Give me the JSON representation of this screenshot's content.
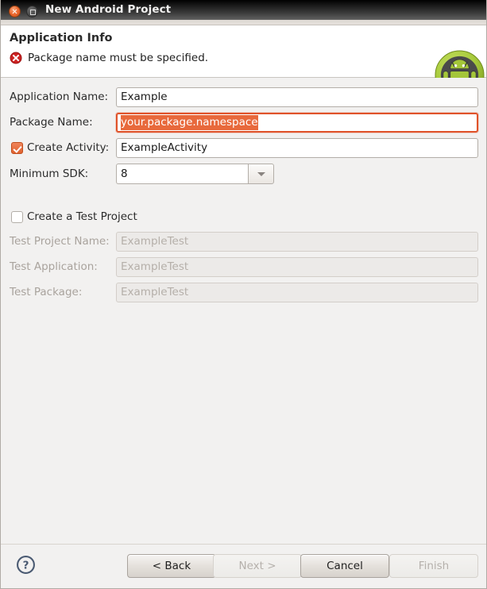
{
  "window": {
    "title": "New Android Project",
    "close_icon": "close-icon",
    "maximize_icon": "maximize-icon"
  },
  "header": {
    "title": "Application Info",
    "error_icon": "error-icon",
    "error_message": "Package name must be specified.",
    "logo_icon": "android-robot-icon"
  },
  "form": {
    "application_name": {
      "label": "Application Name:",
      "value": "Example"
    },
    "package_name": {
      "label": "Package Name:",
      "value": "your.package.namespace",
      "focused": true,
      "selected": true
    },
    "create_activity": {
      "label": "Create Activity:",
      "checked": true,
      "value": "ExampleActivity"
    },
    "minimum_sdk": {
      "label": "Minimum SDK:",
      "value": "8",
      "dropdown_icon": "chevron-down-icon"
    },
    "create_test_project": {
      "label": "Create a Test Project",
      "checked": false
    },
    "test_project_name": {
      "label": "Test Project Name:",
      "value": "ExampleTest",
      "disabled": true
    },
    "test_application": {
      "label": "Test Application:",
      "value": "ExampleTest",
      "disabled": true
    },
    "test_package": {
      "label": "Test Package:",
      "value": "ExampleTest",
      "disabled": true
    }
  },
  "footer": {
    "help_icon": "help-icon",
    "back_label": "< Back",
    "next_label": "Next >",
    "cancel_label": "Cancel",
    "finish_label": "Finish"
  },
  "colors": {
    "accent_orange": "#e0532a",
    "selection_orange": "#e8693c",
    "error_red": "#cc2222",
    "android_green": "#a4c639",
    "body_background": "#f2f1f0"
  }
}
